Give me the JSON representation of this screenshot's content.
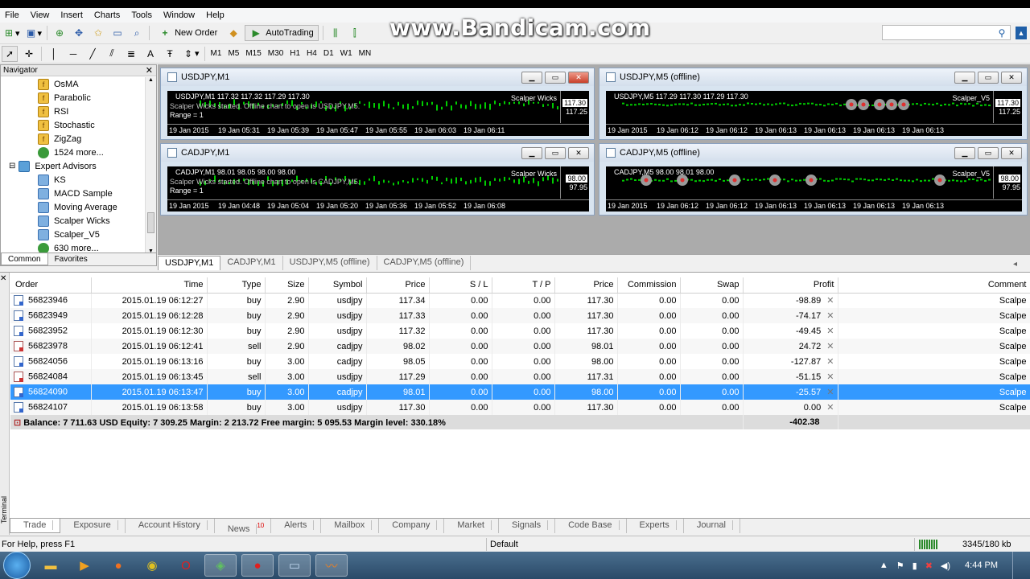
{
  "watermark": "www.Bandicam.com",
  "menu": [
    "File",
    "View",
    "Insert",
    "Charts",
    "Tools",
    "Window",
    "Help"
  ],
  "toolbar": {
    "new_order": "New Order",
    "autotrading": "AutoTrading",
    "timeframes": [
      "M1",
      "M5",
      "M15",
      "M30",
      "H1",
      "H4",
      "D1",
      "W1",
      "MN"
    ]
  },
  "navigator": {
    "title": "Navigator",
    "items": [
      {
        "label": "OsMA",
        "icon": "indicator-icon",
        "indent": 1
      },
      {
        "label": "Parabolic",
        "icon": "indicator-icon",
        "indent": 1
      },
      {
        "label": "RSI",
        "icon": "indicator-icon",
        "indent": 1
      },
      {
        "label": "Stochastic",
        "icon": "indicator-icon",
        "indent": 1
      },
      {
        "label": "ZigZag",
        "icon": "indicator-icon",
        "indent": 1
      },
      {
        "label": "1524 more...",
        "icon": "globe-icon",
        "indent": 1
      },
      {
        "label": "Expert Advisors",
        "icon": "folder-icon",
        "indent": 0
      },
      {
        "label": "KS",
        "icon": "expert-icon",
        "indent": 1
      },
      {
        "label": "MACD Sample",
        "icon": "expert-icon",
        "indent": 1
      },
      {
        "label": "Moving Average",
        "icon": "expert-icon",
        "indent": 1
      },
      {
        "label": "Scalper Wicks",
        "icon": "expert-icon",
        "indent": 1
      },
      {
        "label": "Scalper_V5",
        "icon": "expert-icon",
        "indent": 1
      },
      {
        "label": "630 more...",
        "icon": "globe-icon",
        "indent": 1
      }
    ],
    "tabs": [
      "Common",
      "Favorites"
    ]
  },
  "charts": [
    {
      "title": "USDJPY,M1",
      "info": "USDJPY,M1  117.32 117.32 117.29 117.30",
      "indicator": "Scalper Wicks",
      "msg": "Scalper Wicks started. Offline chart to open is USDJPY,M5.",
      "range": "Range = 1",
      "price1": "117.30",
      "price2": "117.25",
      "xlabels": [
        "19 Jan 2015",
        "19 Jan 05:31",
        "19 Jan 05:39",
        "19 Jan 05:47",
        "19 Jan 05:55",
        "19 Jan 06:03",
        "19 Jan 06:11"
      ]
    },
    {
      "title": "USDJPY,M5 (offline)",
      "info": "USDJPY,M5  117.29 117.30 117.29 117.30",
      "indicator": "Scalper_V5",
      "msg": "",
      "range": "",
      "price1": "117.30",
      "price2": "117.25",
      "xlabels": [
        "19 Jan 2015",
        "19 Jan 06:12",
        "19 Jan 06:12",
        "19 Jan 06:13",
        "19 Jan 06:13",
        "19 Jan 06:13",
        "19 Jan 06:13"
      ]
    },
    {
      "title": "CADJPY,M1",
      "info": "CADJPY,M1  98.01 98.05 98.00 98.00",
      "indicator": "Scalper Wicks",
      "msg": "Scalper Wicks started. Offline chart to open is CADJPY,M5.",
      "range": "Range = 1",
      "price1": "98.00",
      "price2": "97.95",
      "xlabels": [
        "19 Jan 2015",
        "19 Jan 04:48",
        "19 Jan 05:04",
        "19 Jan 05:20",
        "19 Jan 05:36",
        "19 Jan 05:52",
        "19 Jan 06:08"
      ]
    },
    {
      "title": "CADJPY,M5 (offline)",
      "info": "CADJPY,M5  98.00 98.01 98.00",
      "indicator": "Scalper_V5",
      "msg": "",
      "range": "",
      "price1": "98.00",
      "price2": "97.95",
      "xlabels": [
        "19 Jan 2015",
        "19 Jan 06:12",
        "19 Jan 06:12",
        "19 Jan 06:13",
        "19 Jan 06:13",
        "19 Jan 06:13",
        "19 Jan 06:13"
      ]
    }
  ],
  "chart_tabs": [
    "USDJPY,M1",
    "CADJPY,M1",
    "USDJPY,M5 (offline)",
    "CADJPY,M5 (offline)"
  ],
  "trade_table": {
    "headers": [
      "Order",
      "Time",
      "Type",
      "Size",
      "Symbol",
      "Price",
      "S / L",
      "T / P",
      "Price",
      "Commission",
      "Swap",
      "Profit",
      "Comment"
    ],
    "rows": [
      {
        "order": "56823946",
        "time": "2015.01.19 06:12:27",
        "type": "buy",
        "size": "2.90",
        "symbol": "usdjpy",
        "price": "117.34",
        "sl": "0.00",
        "tp": "0.00",
        "cur": "117.30",
        "comm": "0.00",
        "swap": "0.00",
        "profit": "-98.89",
        "comment": "Scalpe"
      },
      {
        "order": "56823949",
        "time": "2015.01.19 06:12:28",
        "type": "buy",
        "size": "2.90",
        "symbol": "usdjpy",
        "price": "117.33",
        "sl": "0.00",
        "tp": "0.00",
        "cur": "117.30",
        "comm": "0.00",
        "swap": "0.00",
        "profit": "-74.17",
        "comment": "Scalpe"
      },
      {
        "order": "56823952",
        "time": "2015.01.19 06:12:30",
        "type": "buy",
        "size": "2.90",
        "symbol": "usdjpy",
        "price": "117.32",
        "sl": "0.00",
        "tp": "0.00",
        "cur": "117.30",
        "comm": "0.00",
        "swap": "0.00",
        "profit": "-49.45",
        "comment": "Scalpe"
      },
      {
        "order": "56823978",
        "time": "2015.01.19 06:12:41",
        "type": "sell",
        "size": "2.90",
        "symbol": "cadjpy",
        "price": "98.02",
        "sl": "0.00",
        "tp": "0.00",
        "cur": "98.01",
        "comm": "0.00",
        "swap": "0.00",
        "profit": "24.72",
        "comment": "Scalpe"
      },
      {
        "order": "56824056",
        "time": "2015.01.19 06:13:16",
        "type": "buy",
        "size": "3.00",
        "symbol": "cadjpy",
        "price": "98.05",
        "sl": "0.00",
        "tp": "0.00",
        "cur": "98.00",
        "comm": "0.00",
        "swap": "0.00",
        "profit": "-127.87",
        "comment": "Scalpe"
      },
      {
        "order": "56824084",
        "time": "2015.01.19 06:13:45",
        "type": "sell",
        "size": "3.00",
        "symbol": "usdjpy",
        "price": "117.29",
        "sl": "0.00",
        "tp": "0.00",
        "cur": "117.31",
        "comm": "0.00",
        "swap": "0.00",
        "profit": "-51.15",
        "comment": "Scalpe"
      },
      {
        "order": "56824090",
        "time": "2015.01.19 06:13:47",
        "type": "buy",
        "size": "3.00",
        "symbol": "cadjpy",
        "price": "98.01",
        "sl": "0.00",
        "tp": "0.00",
        "cur": "98.00",
        "comm": "0.00",
        "swap": "0.00",
        "profit": "-25.57",
        "comment": "Scalpe",
        "selected": true
      },
      {
        "order": "56824107",
        "time": "2015.01.19 06:13:58",
        "type": "buy",
        "size": "3.00",
        "symbol": "usdjpy",
        "price": "117.30",
        "sl": "0.00",
        "tp": "0.00",
        "cur": "117.30",
        "comm": "0.00",
        "swap": "0.00",
        "profit": "0.00",
        "comment": "Scalpe"
      }
    ],
    "balance_line": "Balance: 7 711.63 USD  Equity: 7 309.25  Margin: 2 213.72  Free margin: 5 095.53  Margin level: 330.18%",
    "total_profit": "-402.38"
  },
  "terminal_label": "Terminal",
  "terminal_tabs": [
    "Trade",
    "Exposure",
    "Account History",
    "News",
    "Alerts",
    "Mailbox",
    "Company",
    "Market",
    "Signals",
    "Code Base",
    "Experts",
    "Journal"
  ],
  "news_count": "10",
  "status": {
    "help": "For Help, press F1",
    "profile": "Default",
    "traffic": "3345/180 kb"
  },
  "clock": "4:44 PM",
  "colors": {
    "selection": "#3399ff",
    "chart_bg": "#000000",
    "candles": "#00cc00"
  }
}
